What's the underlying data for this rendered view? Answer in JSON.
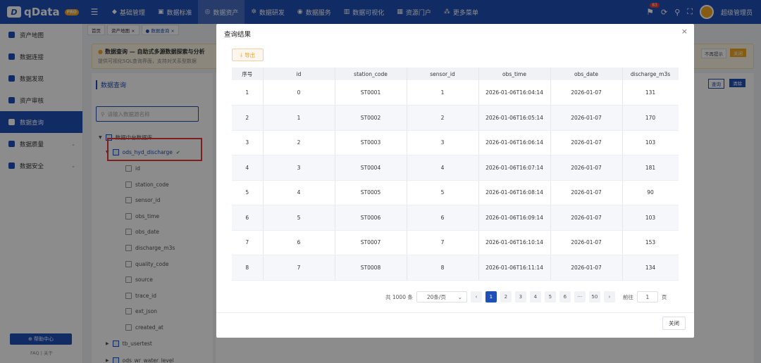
{
  "app": {
    "logo": "qData",
    "logo_badge": "PRO"
  },
  "topnav": [
    {
      "label": "基础管理",
      "icon": "cube-icon"
    },
    {
      "label": "数据标准",
      "icon": "book-icon"
    },
    {
      "label": "数据资产",
      "icon": "target-icon",
      "active": true
    },
    {
      "label": "数据研发",
      "icon": "gear-icon"
    },
    {
      "label": "数据服务",
      "icon": "service-icon"
    },
    {
      "label": "数据可视化",
      "icon": "chart-icon"
    },
    {
      "label": "资源门户",
      "icon": "grid-icon"
    },
    {
      "label": "更多菜单",
      "icon": "apps-icon"
    }
  ],
  "topbar": {
    "bell_count": "83",
    "user_name": "超级管理员"
  },
  "sidebar": {
    "items": [
      {
        "label": "资产地图"
      },
      {
        "label": "数据连接"
      },
      {
        "label": "数据发现"
      },
      {
        "label": "资产审核"
      },
      {
        "label": "数据查询",
        "active": true
      },
      {
        "label": "数据质量",
        "caret": "⌄"
      },
      {
        "label": "数据安全",
        "caret": "⌄"
      }
    ],
    "help": "帮助中心",
    "footer": "FAQ  |  关于"
  },
  "tabs": [
    {
      "label": "首页"
    },
    {
      "label": "资产地图 ×"
    },
    {
      "label": "● 数据查询 ×",
      "active": true
    }
  ],
  "banner": {
    "title": "数据查询 — 自助式多源数据探索与分析",
    "subtitle": "提供可视化SQL查询界面，支持对关系型数据",
    "hide": "不再提示",
    "close": "关闭"
  },
  "left_panel": {
    "title": "数据查询",
    "search_placeholder": "请输入数据源名称",
    "root_node": "数据中台数据库",
    "selected_table": "ods_hyd_discharge",
    "fields": [
      "id",
      "station_code",
      "sensor_id",
      "obs_time",
      "obs_date",
      "discharge_m3s",
      "quality_code",
      "source",
      "trace_id",
      "ext_json",
      "created_at"
    ],
    "other_tables": [
      "tb_usertest",
      "ods_wr_water_level"
    ]
  },
  "right_panel": {
    "query": "查询",
    "clear": "清除"
  },
  "modal": {
    "title": "查询结果",
    "export": "导出",
    "columns": [
      "序号",
      "id",
      "station_code",
      "sensor_id",
      "obs_time",
      "obs_date",
      "discharge_m3s"
    ],
    "rows": [
      [
        "1",
        "0",
        "ST0001",
        "1",
        "2026-01-06T16:04:14",
        "2026-01-07",
        "131"
      ],
      [
        "2",
        "1",
        "ST0002",
        "2",
        "2026-01-06T16:05:14",
        "2026-01-07",
        "170"
      ],
      [
        "3",
        "2",
        "ST0003",
        "3",
        "2026-01-06T16:06:14",
        "2026-01-07",
        "103"
      ],
      [
        "4",
        "3",
        "ST0004",
        "4",
        "2026-01-06T16:07:14",
        "2026-01-07",
        "181"
      ],
      [
        "5",
        "4",
        "ST0005",
        "5",
        "2026-01-06T16:08:14",
        "2026-01-07",
        "90"
      ],
      [
        "6",
        "5",
        "ST0006",
        "6",
        "2026-01-06T16:09:14",
        "2026-01-07",
        "103"
      ],
      [
        "7",
        "6",
        "ST0007",
        "7",
        "2026-01-06T16:10:14",
        "2026-01-07",
        "153"
      ],
      [
        "8",
        "7",
        "ST0008",
        "8",
        "2026-01-06T16:11:14",
        "2026-01-07",
        "134"
      ]
    ],
    "pagination": {
      "total": "共 1000 条",
      "page_size": "20条/页",
      "pages": [
        "1",
        "2",
        "3",
        "4",
        "5",
        "6",
        "···",
        "50"
      ],
      "current": "1",
      "goto_label": "前往",
      "goto_value": "1",
      "goto_suffix": "页"
    },
    "close_label": "关闭"
  }
}
